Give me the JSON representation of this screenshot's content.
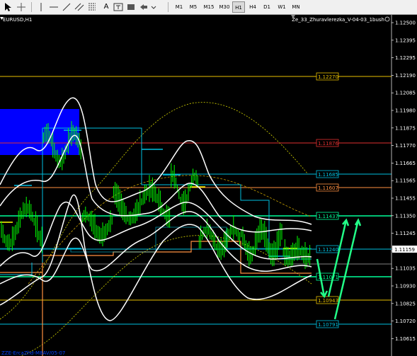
{
  "toolbar": {
    "timeframes": [
      "M1",
      "M5",
      "M15",
      "M30",
      "H1",
      "H4",
      "D1",
      "W1",
      "MN"
    ],
    "active_timeframe": "H1"
  },
  "chart": {
    "symbol_title": "EURUSD,H1",
    "indicator_title": "Ze_33_Zhuravlerezka_V-04-03_1bush",
    "bottom_watermark": "ZZE-ErcaZhd-M8AV/05-07",
    "colors": {
      "background": "#000000",
      "candles": "#00ff00",
      "bands": "#ffffff",
      "cyan_levels": "#00c0e0",
      "orange_line": "#ff9040",
      "yellow_dotted": "#d8d800",
      "blue_zone": "#0000ff",
      "arrows": "#22ff88"
    }
  },
  "price_axis": {
    "ticks": [
      "1.12500",
      "1.12395",
      "1.12295",
      "1.12190",
      "1.12085",
      "1.11980",
      "1.11875",
      "1.11770",
      "1.11665",
      "1.11565",
      "1.11455",
      "1.11350",
      "1.11245",
      "1.11140",
      "1.11035",
      "1.10930",
      "1.10825",
      "1.10720",
      "1.10615"
    ],
    "current_price": "1.11159"
  },
  "levels": [
    {
      "label": "1.12270",
      "color": "#e8c000"
    },
    {
      "label": "1.11876",
      "color": "#e03030"
    },
    {
      "label": "1.11685",
      "color": "#00c0e0"
    },
    {
      "label": "1.11607",
      "color": "#ff9040"
    },
    {
      "label": "1.11437",
      "color": "#00ff99"
    },
    {
      "label": "1.11240",
      "color": "#00c0e0"
    },
    {
      "label": "1.11071",
      "color": "#00ff99"
    },
    {
      "label": "1.10943",
      "color": "#e8c000"
    },
    {
      "label": "1.10791",
      "color": "#00c0e0"
    }
  ]
}
